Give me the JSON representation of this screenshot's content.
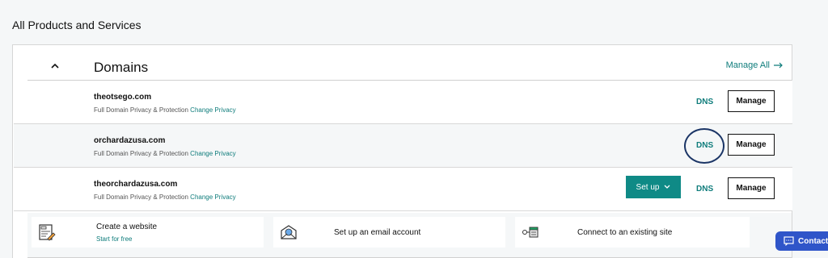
{
  "page": {
    "title": "All Products and Services"
  },
  "domains_section": {
    "title": "Domains",
    "manage_all": "Manage All",
    "rows": [
      {
        "domain": "theotsego.com",
        "privacy": "Full Domain Privacy & Protection",
        "privacy_link": "Change Privacy",
        "dns": "DNS",
        "manage": "Manage"
      },
      {
        "domain": "orchardazusa.com",
        "privacy": "Full Domain Privacy & Protection",
        "privacy_link": "Change Privacy",
        "dns": "DNS",
        "manage": "Manage"
      },
      {
        "domain": "theorchardazusa.com",
        "privacy": "Full Domain Privacy & Protection",
        "privacy_link": "Change Privacy",
        "setup": "Set up",
        "dns": "DNS",
        "manage": "Manage"
      }
    ]
  },
  "actions": [
    {
      "title": "Create a website",
      "subtitle": "Start for free",
      "icon": "website-builder-icon"
    },
    {
      "title": "Set up an email account",
      "icon": "email-icon"
    },
    {
      "title": "Connect to an existing site",
      "icon": "connect-site-icon"
    }
  ],
  "contact": {
    "label": "Contact"
  },
  "colors": {
    "accent": "#0e7c7b",
    "setup_button": "#0f8a86",
    "contact_button": "#2f55c9",
    "highlight_circle": "#1b3566"
  }
}
